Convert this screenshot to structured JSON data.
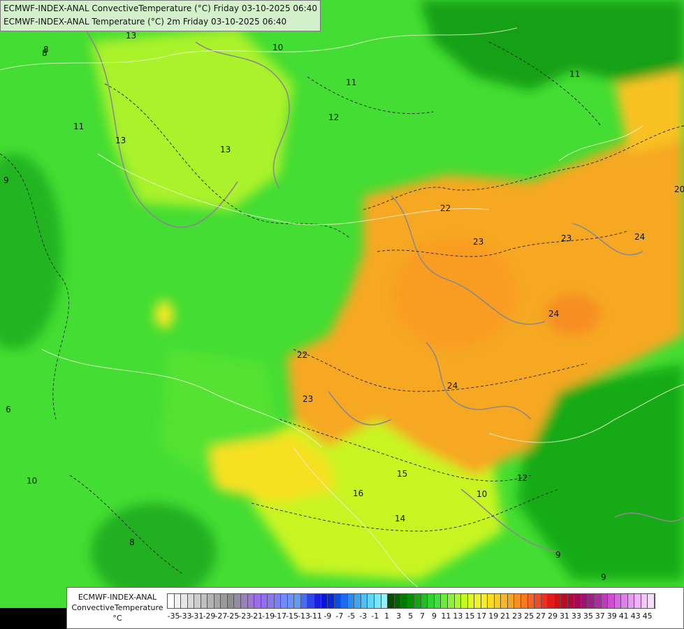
{
  "header": {
    "line1": "ECMWF-INDEX-ANAL ConvectiveTemperature (°C) Friday 03-10-2025 06:40",
    "line2": "ECMWF-INDEX-ANAL Temperature (°C) 2m Friday 03-10-2025 06:40"
  },
  "legend": {
    "line1": "ECMWF-INDEX-ANAL",
    "line2": "ConvectiveTemperature",
    "unit": "°C",
    "tick_labels": [
      "-35",
      "-33",
      "-31",
      "-29",
      "-27",
      "-25",
      "-23",
      "-21",
      "-19",
      "-17",
      "-15",
      "-13",
      "-11",
      "-9",
      "-7",
      "-5",
      "-3",
      "-1",
      "1",
      "3",
      "5",
      "7",
      "9",
      "11",
      "13",
      "15",
      "17",
      "19",
      "21",
      "23",
      "25",
      "27",
      "29",
      "31",
      "33",
      "35",
      "37",
      "39",
      "41",
      "43",
      "45"
    ],
    "colors": [
      "#ffffff",
      "#f2f2f2",
      "#e6e6e6",
      "#d9d9d9",
      "#cccccc",
      "#bfbfbf",
      "#b3b3b3",
      "#a6a6a6",
      "#9a9a9a",
      "#8e8e8e",
      "#948aa6",
      "#9a7fbf",
      "#9f75d6",
      "#9a6ee8",
      "#8f70f0",
      "#8577f5",
      "#7b80f8",
      "#7389fa",
      "#6a92fc",
      "#5f9bfd",
      "#4a6cf0",
      "#2f45e8",
      "#1a1fe0",
      "#0a14d8",
      "#0028e0",
      "#0a4ce6",
      "#1e6cee",
      "#2c8af3",
      "#3aa6f6",
      "#4cc0fa",
      "#5fd6fd",
      "#7ae6ff",
      "#95f0ff",
      "#004d00",
      "#006300",
      "#007a00",
      "#009100",
      "#10a810",
      "#22bd22",
      "#33d033",
      "#40e040",
      "#66ee33",
      "#8cf533",
      "#aafa2a",
      "#c6fb22",
      "#dffb22",
      "#eef522",
      "#f7ec22",
      "#fbdc22",
      "#fccb22",
      "#fbb822",
      "#f9a322",
      "#f78e22",
      "#f67a22",
      "#f56422",
      "#f24a22",
      "#ee2f22",
      "#e21a1a",
      "#d00f16",
      "#bf0a22",
      "#b0083a",
      "#a30a55",
      "#a01070",
      "#a51a8a",
      "#b028a3",
      "#bd3abb",
      "#cb4fd0",
      "#d866e2",
      "#e07ef0",
      "#e898f7",
      "#efb3fb",
      "#f3c8fd",
      "#f8dcfe"
    ]
  },
  "map_labels": [
    {
      "text": "13"
    },
    {
      "text": "10"
    },
    {
      "text": "8"
    },
    {
      "text": "11"
    },
    {
      "text": "12"
    },
    {
      "text": "13"
    },
    {
      "text": "11"
    },
    {
      "text": "13"
    },
    {
      "text": "9"
    },
    {
      "text": "22"
    },
    {
      "text": "23"
    },
    {
      "text": "23"
    },
    {
      "text": "24"
    },
    {
      "text": "24"
    },
    {
      "text": "22"
    },
    {
      "text": "23"
    },
    {
      "text": "24"
    },
    {
      "text": "20"
    },
    {
      "text": "15"
    },
    {
      "text": "14"
    },
    {
      "text": "16"
    },
    {
      "text": "12"
    },
    {
      "text": "10"
    },
    {
      "text": "8"
    },
    {
      "text": "10"
    },
    {
      "text": "9"
    },
    {
      "text": "11"
    },
    {
      "text": "9"
    },
    {
      "text": "6"
    },
    {
      "text": "8"
    }
  ]
}
